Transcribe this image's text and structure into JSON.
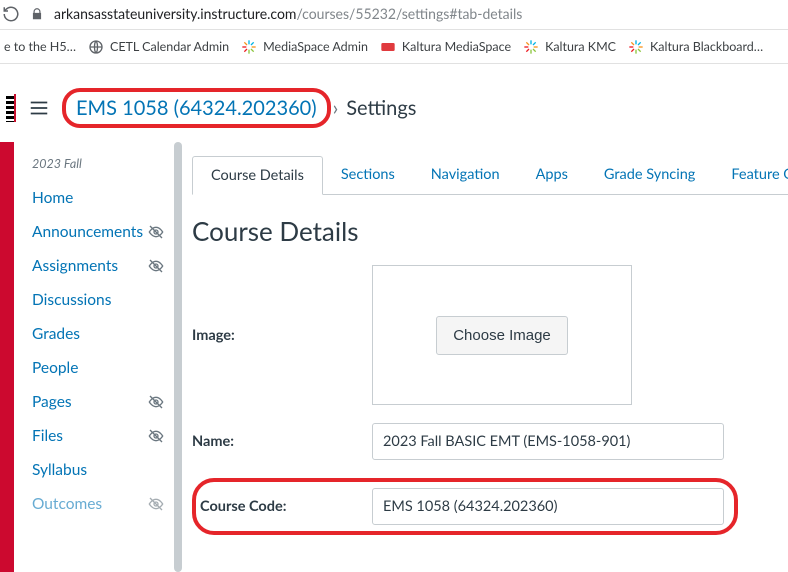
{
  "browser": {
    "url_host": "arkansasstateuniversity.instructure.com",
    "url_path": "/courses/55232/settings#tab-details"
  },
  "bookmarks": {
    "0": "e to the H5…",
    "1": "CETL Calendar Admin",
    "2": "MediaSpace Admin",
    "3": "Kaltura MediaSpace",
    "4": "Kaltura KMC",
    "5": "Kaltura Blackboard…"
  },
  "breadcrumb": {
    "course_link": "EMS 1058 (64324.202360)",
    "sep": "›",
    "current": "Settings"
  },
  "sidenav": {
    "term": "2023 Fall",
    "items": {
      "0": "Home",
      "1": "Announcements",
      "2": "Assignments",
      "3": "Discussions",
      "4": "Grades",
      "5": "People",
      "6": "Pages",
      "7": "Files",
      "8": "Syllabus",
      "9": "Outcomes"
    }
  },
  "tabs": {
    "0": "Course Details",
    "1": "Sections",
    "2": "Navigation",
    "3": "Apps",
    "4": "Grade Syncing",
    "5": "Feature O"
  },
  "page": {
    "title": "Course Details",
    "image_label": "Image:",
    "choose_image": "Choose Image",
    "name_label": "Name:",
    "name_value": "2023 Fall BASIC EMT (EMS-1058-901)",
    "code_label": "Course Code:",
    "code_value": "EMS 1058 (64324.202360)"
  }
}
